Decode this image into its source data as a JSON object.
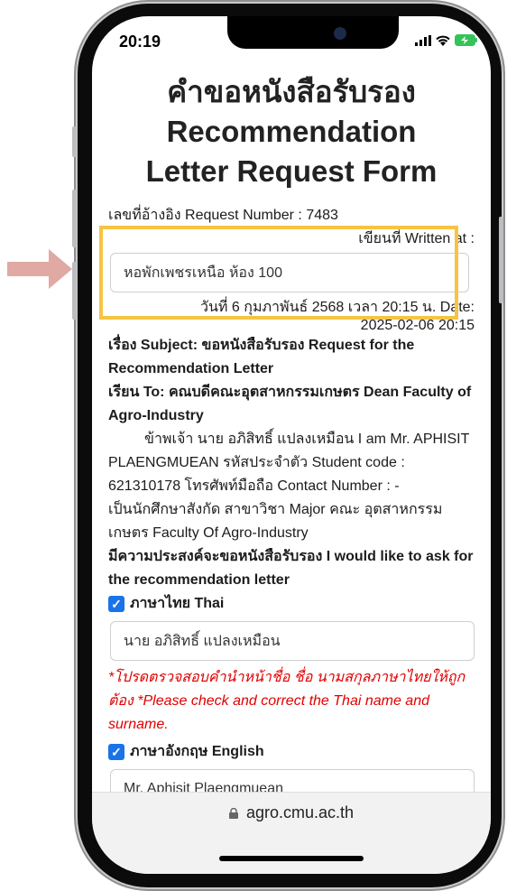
{
  "status": {
    "time": "20:19"
  },
  "title_lines": [
    "คำขอหนังสือรับรอง",
    "Recommendation",
    "Letter Request Form"
  ],
  "request_number": {
    "label": "เลขที่อ้างอิง Request Number :",
    "value": "7483"
  },
  "written_at": {
    "label": "เขียนที่ Written at :",
    "value": "หอพักเพชรเหนือ ห้อง 100"
  },
  "date_line": "วันที่ 6 กุมภาพันธ์ 2568 เวลา 20:15 น. Date:",
  "date_value": "2025-02-06 20:15",
  "subject": {
    "label": "เรื่อง Subject:",
    "value": "ขอหนังสือรับรอง Request for the Recommendation Letter"
  },
  "to": {
    "label": "เรียน To:",
    "value": "คณบดีคณะอุตสาหกรรมเกษตร Dean Faculty of Agro-Industry"
  },
  "body": {
    "p1": "ข้าพเจ้า นาย อภิสิทธิ์ แปลงเหมือน I am Mr. APHISIT PLAENGMUEAN รหัสประจำตัว Student code : 621310178 โทรศัพท์มือถือ Contact Number : -",
    "p2": "เป็นนักศึกษาสังกัด สาขาวิชา Major คณะ อุตสาหกรรมเกษตร Faculty Of Agro-Industry",
    "p3": "มีความประสงค์จะขอหนังสือรับรอง I would like to ask for the recommendation letter"
  },
  "thai_option": {
    "label": "ภาษาไทย Thai",
    "checked": true,
    "value": "นาย อภิสิทธิ์ แปลงเหมือน",
    "note": "*โปรดตรวจสอบคำนำหน้าชื่อ ชื่อ นามสกุลภาษาไทยให้ถูกต้อง *Please check and correct the Thai name and surname."
  },
  "english_option": {
    "label": "ภาษาอังกฤษ English",
    "checked": true,
    "value": "Mr. Aphisit Plaengmuean"
  },
  "browser": {
    "url": "agro.cmu.ac.th"
  },
  "colors": {
    "highlight": "#f5c542",
    "checkbox": "#1a73e8",
    "note": "#e00000",
    "arrow": "#e0a9a4"
  }
}
